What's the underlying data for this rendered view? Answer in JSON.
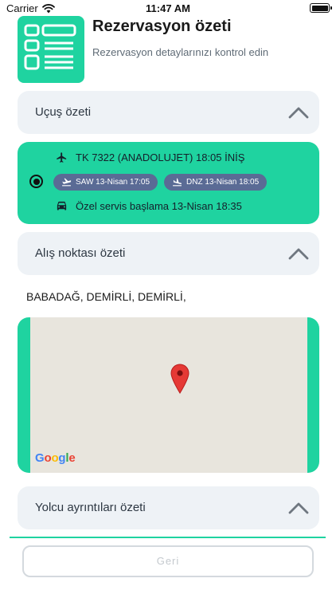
{
  "status_bar": {
    "carrier": "Carrier",
    "time": "11:47 AM"
  },
  "header": {
    "title": "Rezervasyon özeti",
    "subtitle": "Rezervasyon detaylarınızı kontrol edin",
    "icon": "document-list-icon"
  },
  "flight_section": {
    "title": "Uçuş özeti",
    "expanded": true,
    "flight": {
      "selected": true,
      "flight_text": "TK 7322 (ANADOLUJET) 18:05 İNİŞ",
      "departure_chip": "SAW 13-Nisan  17:05",
      "arrival_chip": "DNZ 13-Nisan  18:05",
      "service_text": "Özel servis başlama 13-Nisan  18:35"
    }
  },
  "pickup_section": {
    "title": "Alış noktası özeti",
    "expanded": true,
    "address": "BABADAĞ, DEMİRLİ, DEMİRLİ,"
  },
  "passenger_section": {
    "title": "Yolcu ayrıntıları özeti",
    "expanded": true
  },
  "footer": {
    "back_label": "Geri"
  },
  "colors": {
    "accent": "#1fd3a0",
    "chip": "#5a6b95",
    "card": "#eef2f6",
    "pin": "#e53935"
  }
}
